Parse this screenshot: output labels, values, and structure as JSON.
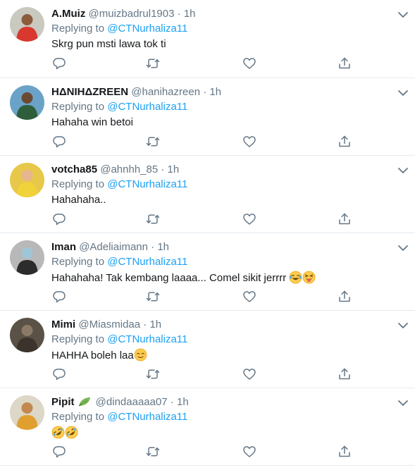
{
  "tweets": [
    {
      "name": "A.Muiz",
      "handle": "@muizbadrul1903",
      "dot": "·",
      "time": "1h",
      "reply_prefix": "Replying to",
      "mention": "@CTNurhaliza11",
      "text": "Skrg pun msti lawa tok ti",
      "emojis": [],
      "name_emoji": "",
      "avatar": {
        "bg": "#c9c9c0",
        "body": "#d8382e",
        "skin": "#8a5b3c"
      }
    },
    {
      "name": "HΔNIHΔZREEN",
      "handle": "@hanihazreen",
      "dot": "·",
      "time": "1h",
      "reply_prefix": "Replying to",
      "mention": "@CTNurhaliza11",
      "text": "Hahaha win betoi",
      "emojis": [],
      "name_emoji": "",
      "avatar": {
        "bg": "#6aa3c7",
        "body": "#2f5f3a",
        "skin": "#6b4a33"
      }
    },
    {
      "name": "votcha85",
      "handle": "@ahnhh_85",
      "dot": "·",
      "time": "1h",
      "reply_prefix": "Replying to",
      "mention": "@CTNurhaliza11",
      "text": "Hahahaha..",
      "emojis": [],
      "name_emoji": "",
      "avatar": {
        "bg": "#e7c84a",
        "body": "#f0d23b",
        "skin": "#e7b58f"
      }
    },
    {
      "name": "Iman",
      "handle": "@Adeliaimann",
      "dot": "·",
      "time": "1h",
      "reply_prefix": "Replying to",
      "mention": "@CTNurhaliza11",
      "text": "Hahahaha! Tak kembang laaaa... Comel sikit jerrrr ",
      "emojis": [
        "joy-emoji",
        "squinting-tongue-emoji"
      ],
      "name_emoji": "",
      "avatar": {
        "bg": "#b8b8b8",
        "body": "#2c2c2c",
        "skin": "#9fc7d8"
      }
    },
    {
      "name": "Mimi",
      "handle": "@Miasmidaa",
      "dot": "·",
      "time": "1h",
      "reply_prefix": "Replying to",
      "mention": "@CTNurhaliza11",
      "text": "HAHHA boleh laa",
      "emojis": [
        "smiling-eyes-emoji"
      ],
      "name_emoji": "",
      "avatar": {
        "bg": "#5a5246",
        "body": "#3c342c",
        "skin": "#8d7a66"
      }
    },
    {
      "name": "Pipit",
      "handle": "@dindaaaaa07",
      "dot": "·",
      "time": "1h",
      "reply_prefix": "Replying to",
      "mention": "@CTNurhaliza11",
      "text": "",
      "emojis": [
        "rofl-emoji",
        "rofl-emoji"
      ],
      "name_emoji": "leaf-emoji",
      "avatar": {
        "bg": "#dcd7c6",
        "body": "#e0a030",
        "skin": "#c3874f"
      }
    }
  ],
  "colors": {
    "accent": "#1da1f2",
    "muted": "#657786",
    "divider": "#e6ecf0"
  }
}
